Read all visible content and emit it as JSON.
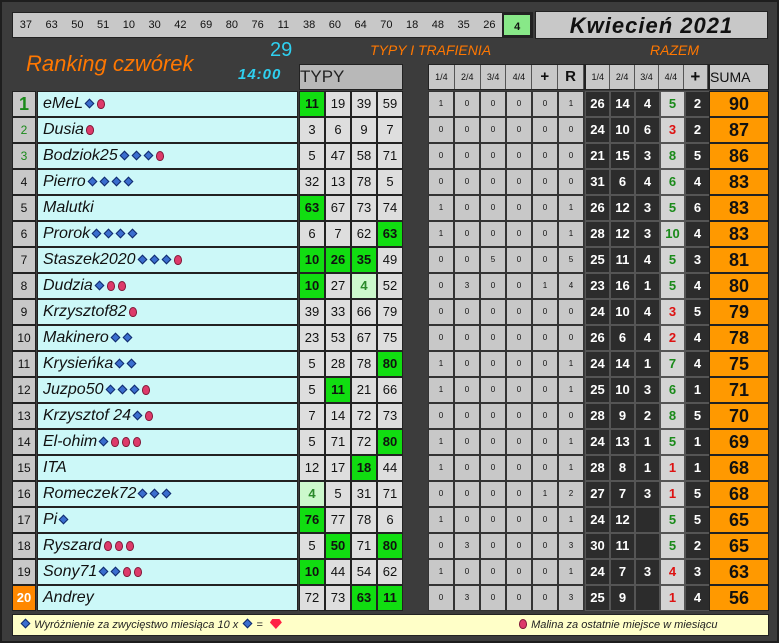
{
  "top_numbers": [
    "37",
    "63",
    "50",
    "51",
    "10",
    "30",
    "42",
    "69",
    "80",
    "76",
    "11",
    "38",
    "60",
    "64",
    "70",
    "18",
    "48",
    "35",
    "26",
    "4"
  ],
  "highlighted_number": "4",
  "month_title": "Kwiecień 2021",
  "ranking_title": "Ranking czwórek",
  "draw_number": "29",
  "draw_time": "14:00",
  "section_typy_trafienia": "TYPY I TRAFIENIA",
  "section_razem": "RAZEM",
  "header": {
    "typy": "TYPY",
    "trafienia": [
      "1/4",
      "2/4",
      "3/4",
      "4/4",
      "+",
      "R"
    ],
    "razem": [
      "1/4",
      "2/4",
      "3/4",
      "4/4",
      "+"
    ],
    "suma": "SUMA"
  },
  "rows": [
    {
      "rank": "1",
      "name": "eMeL",
      "dia": 1,
      "rasp": 1,
      "typy": [
        [
          "11",
          "g"
        ],
        [
          "19",
          ""
        ],
        [
          "39",
          ""
        ],
        [
          "59",
          ""
        ]
      ],
      "tr": [
        "1",
        "0",
        "0",
        "0",
        "0",
        "1"
      ],
      "rz": [
        "26",
        "14",
        "4",
        "5",
        "2"
      ],
      "red4": false,
      "sum": "90"
    },
    {
      "rank": "2",
      "name": "Dusia",
      "dia": 0,
      "rasp": 1,
      "typy": [
        [
          "3",
          ""
        ],
        [
          "6",
          ""
        ],
        [
          "9",
          ""
        ],
        [
          "7",
          ""
        ]
      ],
      "tr": [
        "0",
        "0",
        "0",
        "0",
        "0",
        "0"
      ],
      "rz": [
        "24",
        "10",
        "6",
        "3",
        "2"
      ],
      "red4": true,
      "sum": "87"
    },
    {
      "rank": "3",
      "name": "Bodziok25",
      "dia": 3,
      "rasp": 1,
      "typy": [
        [
          "5",
          ""
        ],
        [
          "47",
          ""
        ],
        [
          "58",
          ""
        ],
        [
          "71",
          ""
        ]
      ],
      "tr": [
        "0",
        "0",
        "0",
        "0",
        "0",
        "0"
      ],
      "rz": [
        "21",
        "15",
        "3",
        "8",
        "5"
      ],
      "red4": false,
      "sum": "86"
    },
    {
      "rank": "4",
      "name": "Pierro",
      "dia": 4,
      "rasp": 0,
      "typy": [
        [
          "32",
          ""
        ],
        [
          "13",
          ""
        ],
        [
          "78",
          ""
        ],
        [
          "5",
          ""
        ]
      ],
      "tr": [
        "0",
        "0",
        "0",
        "0",
        "0",
        "0"
      ],
      "rz": [
        "31",
        "6",
        "4",
        "6",
        "4"
      ],
      "red4": false,
      "sum": "83"
    },
    {
      "rank": "5",
      "name": "Malutki",
      "dia": 0,
      "rasp": 0,
      "typy": [
        [
          "63",
          "g"
        ],
        [
          "67",
          ""
        ],
        [
          "73",
          ""
        ],
        [
          "74",
          ""
        ]
      ],
      "tr": [
        "1",
        "0",
        "0",
        "0",
        "0",
        "1"
      ],
      "rz": [
        "26",
        "12",
        "3",
        "5",
        "6"
      ],
      "red4": false,
      "sum": "83"
    },
    {
      "rank": "6",
      "name": "Prorok",
      "dia": 4,
      "rasp": 0,
      "typy": [
        [
          "6",
          ""
        ],
        [
          "7",
          ""
        ],
        [
          "62",
          ""
        ],
        [
          "63",
          "g"
        ]
      ],
      "tr": [
        "1",
        "0",
        "0",
        "0",
        "0",
        "1"
      ],
      "rz": [
        "28",
        "12",
        "3",
        "10",
        "4"
      ],
      "red4": false,
      "sum": "83"
    },
    {
      "rank": "7",
      "name": "Staszek2020",
      "dia": 3,
      "rasp": 1,
      "typy": [
        [
          "10",
          "g"
        ],
        [
          "26",
          "g"
        ],
        [
          "35",
          "g"
        ],
        [
          "49",
          ""
        ]
      ],
      "tr": [
        "0",
        "0",
        "5",
        "0",
        "0",
        "5"
      ],
      "rz": [
        "25",
        "11",
        "4",
        "5",
        "3"
      ],
      "red4": false,
      "sum": "81"
    },
    {
      "rank": "8",
      "name": "Dudzia",
      "dia": 1,
      "rasp": 2,
      "typy": [
        [
          "10",
          "g"
        ],
        [
          "27",
          ""
        ],
        [
          "4",
          "lg"
        ],
        [
          "52",
          ""
        ]
      ],
      "tr": [
        "0",
        "3",
        "0",
        "0",
        "1",
        "4"
      ],
      "rz": [
        "23",
        "16",
        "1",
        "5",
        "4"
      ],
      "red4": false,
      "sum": "80"
    },
    {
      "rank": "9",
      "name": "Krzysztof82",
      "dia": 0,
      "rasp": 1,
      "typy": [
        [
          "39",
          ""
        ],
        [
          "33",
          ""
        ],
        [
          "66",
          ""
        ],
        [
          "79",
          ""
        ]
      ],
      "tr": [
        "0",
        "0",
        "0",
        "0",
        "0",
        "0"
      ],
      "rz": [
        "24",
        "10",
        "4",
        "3",
        "5"
      ],
      "red4": true,
      "sum": "79"
    },
    {
      "rank": "10",
      "name": "Makinero",
      "dia": 2,
      "rasp": 0,
      "typy": [
        [
          "23",
          ""
        ],
        [
          "53",
          ""
        ],
        [
          "67",
          ""
        ],
        [
          "75",
          ""
        ]
      ],
      "tr": [
        "0",
        "0",
        "0",
        "0",
        "0",
        "0"
      ],
      "rz": [
        "26",
        "6",
        "4",
        "2",
        "4"
      ],
      "red4": true,
      "sum": "78"
    },
    {
      "rank": "11",
      "name": "Krysieńka",
      "dia": 2,
      "rasp": 0,
      "typy": [
        [
          "5",
          ""
        ],
        [
          "28",
          ""
        ],
        [
          "78",
          ""
        ],
        [
          "80",
          "g"
        ]
      ],
      "tr": [
        "1",
        "0",
        "0",
        "0",
        "0",
        "1"
      ],
      "rz": [
        "24",
        "14",
        "1",
        "7",
        "4"
      ],
      "red4": false,
      "sum": "75"
    },
    {
      "rank": "12",
      "name": "Juzpo50",
      "dia": 3,
      "rasp": 1,
      "typy": [
        [
          "5",
          ""
        ],
        [
          "11",
          "g"
        ],
        [
          "21",
          ""
        ],
        [
          "66",
          ""
        ]
      ],
      "tr": [
        "1",
        "0",
        "0",
        "0",
        "0",
        "1"
      ],
      "rz": [
        "25",
        "10",
        "3",
        "6",
        "1"
      ],
      "red4": false,
      "sum": "71"
    },
    {
      "rank": "13",
      "name": "Krzysztof 24",
      "dia": 1,
      "rasp": 1,
      "typy": [
        [
          "7",
          ""
        ],
        [
          "14",
          ""
        ],
        [
          "72",
          ""
        ],
        [
          "73",
          ""
        ]
      ],
      "tr": [
        "0",
        "0",
        "0",
        "0",
        "0",
        "0"
      ],
      "rz": [
        "28",
        "9",
        "2",
        "8",
        "5"
      ],
      "red4": false,
      "sum": "70"
    },
    {
      "rank": "14",
      "name": "El-ohim",
      "dia": 1,
      "rasp": 3,
      "typy": [
        [
          "5",
          ""
        ],
        [
          "71",
          ""
        ],
        [
          "72",
          ""
        ],
        [
          "80",
          "g"
        ]
      ],
      "tr": [
        "1",
        "0",
        "0",
        "0",
        "0",
        "1"
      ],
      "rz": [
        "24",
        "13",
        "1",
        "5",
        "1"
      ],
      "red4": false,
      "sum": "69"
    },
    {
      "rank": "15",
      "name": "ITA",
      "dia": 0,
      "rasp": 0,
      "typy": [
        [
          "12",
          ""
        ],
        [
          "17",
          ""
        ],
        [
          "18",
          "g"
        ],
        [
          "44",
          ""
        ]
      ],
      "tr": [
        "1",
        "0",
        "0",
        "0",
        "0",
        "1"
      ],
      "rz": [
        "28",
        "8",
        "1",
        "1",
        "1"
      ],
      "red4": true,
      "sum": "68"
    },
    {
      "rank": "16",
      "name": "Romeczek72",
      "dia": 3,
      "rasp": 0,
      "typy": [
        [
          "4",
          "lg"
        ],
        [
          "5",
          ""
        ],
        [
          "31",
          ""
        ],
        [
          "71",
          ""
        ]
      ],
      "tr": [
        "0",
        "0",
        "0",
        "0",
        "1",
        "2"
      ],
      "rz": [
        "27",
        "7",
        "3",
        "1",
        "5"
      ],
      "red4": true,
      "sum": "68"
    },
    {
      "rank": "17",
      "name": "Pi",
      "dia": 1,
      "rasp": 0,
      "typy": [
        [
          "76",
          "g"
        ],
        [
          "77",
          ""
        ],
        [
          "78",
          ""
        ],
        [
          "6",
          ""
        ]
      ],
      "tr": [
        "1",
        "0",
        "0",
        "0",
        "0",
        "1"
      ],
      "rz": [
        "24",
        "12",
        "",
        "5",
        "5"
      ],
      "red4": false,
      "sum": "65"
    },
    {
      "rank": "18",
      "name": "Ryszard",
      "dia": 0,
      "rasp": 3,
      "typy": [
        [
          "5",
          ""
        ],
        [
          "50",
          "g"
        ],
        [
          "71",
          ""
        ],
        [
          "80",
          "g"
        ]
      ],
      "tr": [
        "0",
        "3",
        "0",
        "0",
        "0",
        "3"
      ],
      "rz": [
        "30",
        "11",
        "",
        "5",
        "2"
      ],
      "red4": false,
      "sum": "65"
    },
    {
      "rank": "19",
      "name": "Sony71",
      "dia": 2,
      "rasp": 2,
      "typy": [
        [
          "10",
          "g"
        ],
        [
          "44",
          ""
        ],
        [
          "54",
          ""
        ],
        [
          "62",
          ""
        ]
      ],
      "tr": [
        "1",
        "0",
        "0",
        "0",
        "0",
        "1"
      ],
      "rz": [
        "24",
        "7",
        "3",
        "4",
        "3"
      ],
      "red4": true,
      "sum": "63"
    },
    {
      "rank": "20",
      "name": "Andrey",
      "dia": 0,
      "rasp": 0,
      "typy": [
        [
          "72",
          ""
        ],
        [
          "73",
          ""
        ],
        [
          "63",
          "g"
        ],
        [
          "11",
          "g"
        ]
      ],
      "tr": [
        "0",
        "3",
        "0",
        "0",
        "0",
        "3"
      ],
      "rz": [
        "25",
        "9",
        "",
        "1",
        "4"
      ],
      "red4": true,
      "sum": "56"
    }
  ],
  "legend": {
    "left": "Wyróżnienie za zwycięstwo miesiąca  10 x",
    "equals": "=",
    "right": "Malina za ostatnie miejsce w miesiącu"
  }
}
